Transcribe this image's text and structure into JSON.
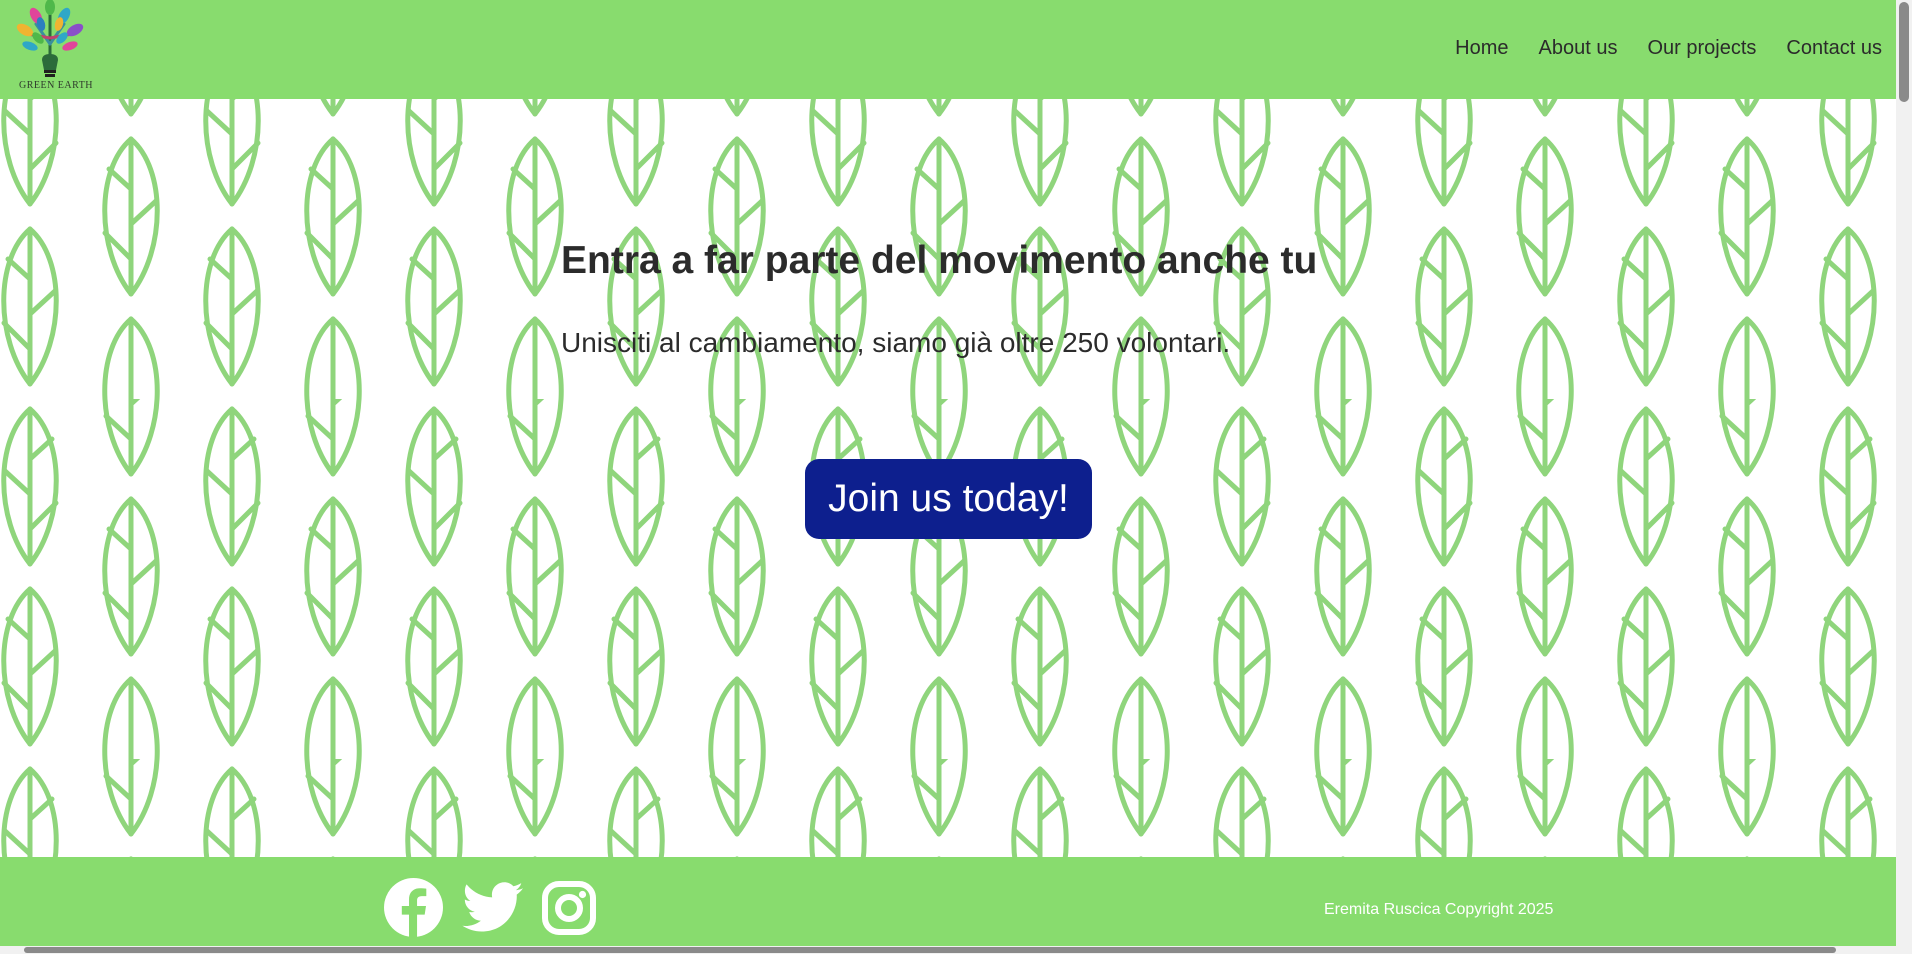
{
  "header": {
    "logo_text": "GREEN EARTH",
    "nav": [
      {
        "label": "Home"
      },
      {
        "label": "About us"
      },
      {
        "label": "Our projects"
      },
      {
        "label": "Contact us"
      }
    ]
  },
  "hero": {
    "title": "Entra a far parte del movimento anche tu",
    "subtitle": "Unisciti al cambiamento, siamo già oltre 250 volontari.",
    "cta_label": "Join us today!"
  },
  "footer": {
    "social_icons": [
      "facebook-icon",
      "twitter-icon",
      "instagram-icon"
    ],
    "copyright": "Eremita Ruscica Copyright 2025"
  },
  "colors": {
    "bar_green": "#88dc6e",
    "leaf_green": "#8fd57c",
    "button_blue": "#0d1f8e",
    "text_dark": "#2b2b2b"
  }
}
